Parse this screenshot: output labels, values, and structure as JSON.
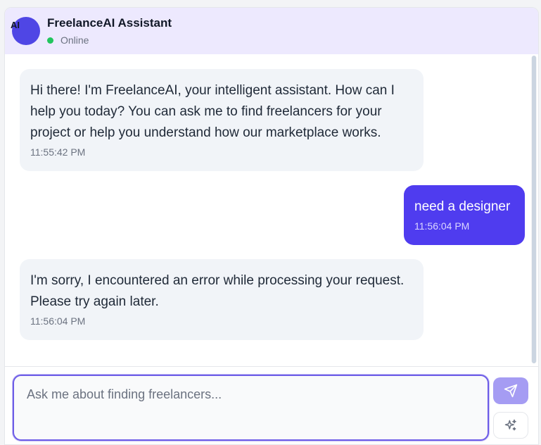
{
  "header": {
    "avatar_text": "AI",
    "title": "FreelanceAI Assistant",
    "status": "Online"
  },
  "messages": [
    {
      "sender": "assistant",
      "text": "Hi there! I'm FreelanceAI, your intelligent assistant. How can I help you today? You can ask me to find freelancers for your project or help you understand how our marketplace works.",
      "time": "11:55:42 PM"
    },
    {
      "sender": "user",
      "text": "need a designer",
      "time": "11:56:04 PM"
    },
    {
      "sender": "assistant",
      "text": "I'm sorry, I encountered an error while processing your request. Please try again later.",
      "time": "11:56:04 PM"
    }
  ],
  "composer": {
    "placeholder": "Ask me about finding freelancers...",
    "value": ""
  },
  "icons": {
    "send": "send-icon",
    "magic": "sparkles-icon"
  },
  "colors": {
    "accent": "#4f3cef",
    "header_bg": "#ede9fe",
    "online": "#22c55e",
    "bot_bubble": "#f1f4f8"
  }
}
